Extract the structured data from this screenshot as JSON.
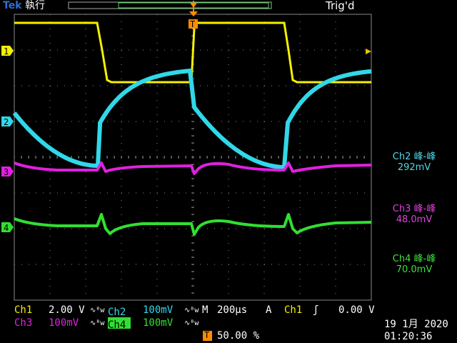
{
  "header": {
    "brand": "Tek",
    "status": "執行",
    "trigger_status": "Trig'd"
  },
  "markers": {
    "ch1": "1",
    "ch2": "2",
    "ch3": "3",
    "ch4": "4",
    "trigger": "T"
  },
  "measurements": [
    {
      "name": "Ch2 峰-峰",
      "value": "292mV",
      "color": "#4fd8e8"
    },
    {
      "name": "Ch3 峰-峰",
      "value": "48.0mV",
      "color": "#e040e0"
    },
    {
      "name": "Ch4 峰-峰",
      "value": "70.0mV",
      "color": "#3ce03c"
    }
  ],
  "bottom": {
    "ch1_label": "Ch1",
    "ch1_scale": "2.00 V",
    "ch2_label": "Ch2",
    "ch2_scale": "100mV",
    "ch3_label": "Ch3",
    "ch3_scale": "100mV",
    "ch4_label": "Ch4",
    "ch4_scale": "100mV",
    "bw_symbol": "∿ᴮw",
    "timebase_label": "M",
    "timebase": "200µs",
    "trigger_mode": "A",
    "trigger_source": "Ch1",
    "trigger_slope": "ʃ",
    "trigger_level": "0.00 V",
    "trigger_position_marker": "T",
    "trigger_position": "50.00 %"
  },
  "datetime": {
    "date": "19 1月  2020",
    "time": "01:20:36"
  },
  "colors": {
    "ch1": "#f5f000",
    "ch2": "#30d8e8",
    "ch3": "#e020e0",
    "ch4": "#30e030",
    "trigger": "#ff8c00",
    "grid": "#8a8a8a"
  }
}
